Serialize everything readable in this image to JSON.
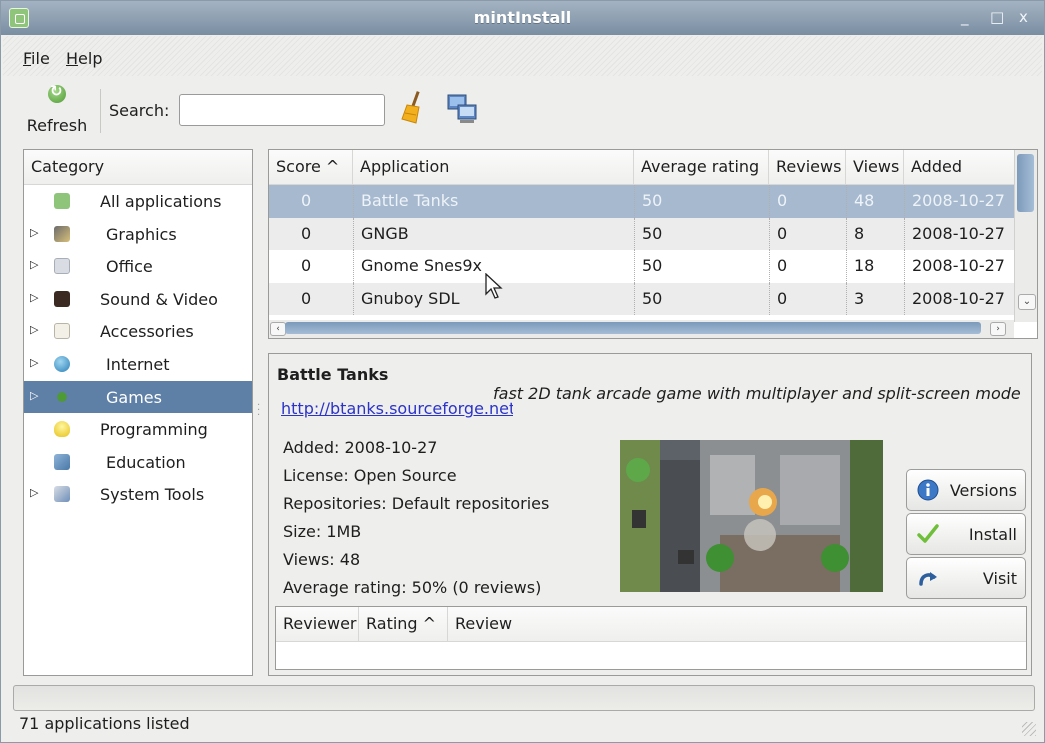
{
  "window": {
    "title": "mintInstall",
    "controls": {
      "minimize": "_",
      "maximize": "□",
      "close": "x"
    }
  },
  "menu": {
    "file_key": "F",
    "file_rest": "ile",
    "help_key": "H",
    "help_rest": "elp"
  },
  "toolbar": {
    "refresh_label": "Refresh",
    "search_label": "Search:",
    "search_value": "",
    "icons": [
      "refresh-icon",
      "broom-icon",
      "network-icon"
    ]
  },
  "categories": {
    "header": "Category",
    "items": [
      {
        "label": "All applications",
        "icon": "mint-icon",
        "expandable": false,
        "selected": false
      },
      {
        "label": "Graphics",
        "icon": "graphics-icon",
        "expandable": true,
        "selected": false
      },
      {
        "label": "Office",
        "icon": "office-icon",
        "expandable": true,
        "selected": false
      },
      {
        "label": "Sound & Video",
        "icon": "sound-video-icon",
        "expandable": true,
        "selected": false
      },
      {
        "label": "Accessories",
        "icon": "accessories-icon",
        "expandable": true,
        "selected": false
      },
      {
        "label": "Internet",
        "icon": "internet-icon",
        "expandable": true,
        "selected": false
      },
      {
        "label": "Games",
        "icon": "games-icon",
        "expandable": true,
        "selected": true
      },
      {
        "label": "Programming",
        "icon": "programming-icon",
        "expandable": false,
        "selected": false
      },
      {
        "label": "Education",
        "icon": "education-icon",
        "expandable": false,
        "selected": false
      },
      {
        "label": "System Tools",
        "icon": "system-tools-icon",
        "expandable": true,
        "selected": false
      }
    ]
  },
  "apps": {
    "columns": [
      "Score ^",
      "Application",
      "Average rating",
      "Reviews",
      "Views",
      "Added"
    ],
    "rows": [
      {
        "score": "0",
        "application": "Battle Tanks",
        "average_rating": "50",
        "reviews": "0",
        "views": "48",
        "added": "2008-10-27",
        "selected": true
      },
      {
        "score": "0",
        "application": "GNGB",
        "average_rating": "50",
        "reviews": "0",
        "views": "8",
        "added": "2008-10-27",
        "selected": false
      },
      {
        "score": "0",
        "application": "Gnome Snes9x",
        "average_rating": "50",
        "reviews": "0",
        "views": "18",
        "added": "2008-10-27",
        "selected": false
      },
      {
        "score": "0",
        "application": "Gnuboy SDL",
        "average_rating": "50",
        "reviews": "0",
        "views": "3",
        "added": "2008-10-27",
        "selected": false
      }
    ]
  },
  "detail": {
    "name": "Battle Tanks",
    "description": "fast 2D tank arcade game with multiplayer and split-screen mode",
    "link": "http://btanks.sourceforge.net",
    "added": "Added: 2008-10-27",
    "license": "License: Open Source",
    "repositories": "Repositories: Default repositories",
    "size": "Size: 1MB",
    "views": "Views: 48",
    "average_rating": "Average rating: 50% (0 reviews)",
    "buttons": {
      "versions": "Versions",
      "install": "Install",
      "visit": "Visit"
    }
  },
  "reviews": {
    "columns": [
      "Reviewer",
      "Rating ^",
      "Review"
    ]
  },
  "status": {
    "text": "71 applications listed"
  },
  "colors": {
    "selection": "#5e7fa6",
    "row_selection": "#a6b9cf",
    "link": "#2b33c9",
    "titlebar": "#8a9bb0"
  }
}
